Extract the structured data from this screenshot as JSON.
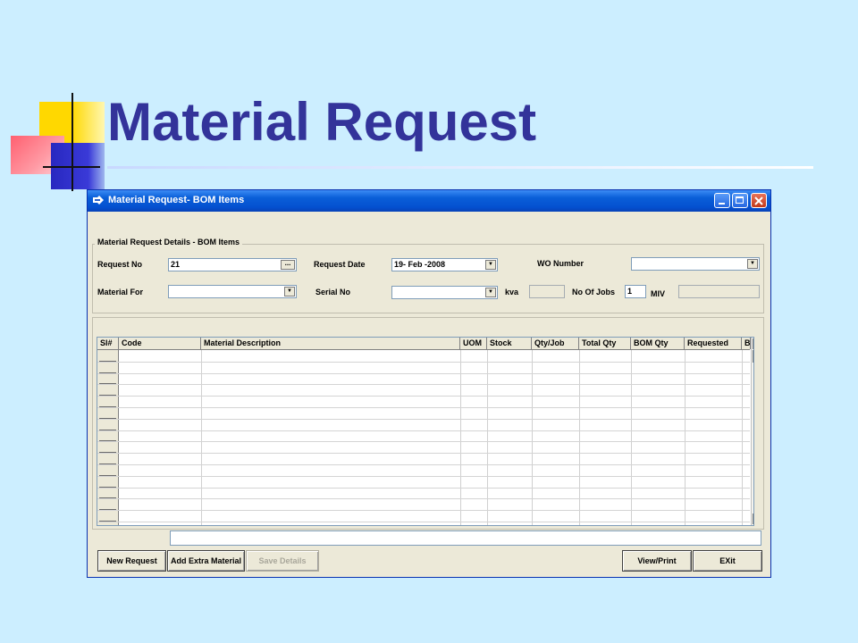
{
  "slide": {
    "title": "Material Request"
  },
  "window": {
    "title": "Material Request- BOM Items",
    "icon": "app-icon"
  },
  "details": {
    "legend": "Material Request Details - BOM Items",
    "request_no_label": "Request No",
    "request_no_value": "21",
    "request_no_button": "...",
    "request_date_label": "Request Date",
    "request_date_value": "19- Feb -2008",
    "wo_number_label": "WO Number",
    "wo_number_value": "",
    "material_for_label": "Material For",
    "material_for_value": "",
    "serial_no_label": "Serial  No",
    "serial_no_value": "",
    "kva_label": "kva",
    "kva_value": "",
    "no_of_jobs_label": "No Of Jobs",
    "no_of_jobs_value": "1",
    "miv_label": "MIV",
    "miv_value": ""
  },
  "grid": {
    "columns": [
      "Sl#",
      "Code",
      "Material Description",
      "UOM",
      "Stock",
      "Qty/Job",
      "Total Qty",
      "BOM Qty",
      "Requested",
      "B"
    ],
    "rows": []
  },
  "buttons": {
    "new_request": "New Request",
    "add_extra_material": "Add Extra Material",
    "save_details": "Save Details",
    "view_print": "View/Print",
    "exit": "EXit"
  }
}
